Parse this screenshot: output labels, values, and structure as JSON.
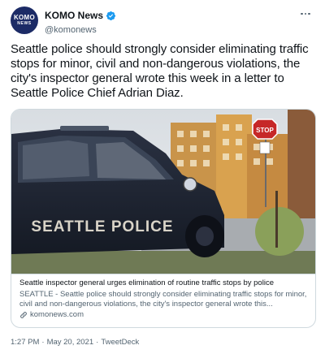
{
  "account": {
    "display_name": "KOMO News",
    "handle": "@komonews",
    "avatar_text_top": "KOMO",
    "avatar_text_bottom": "NEWS",
    "avatar_color": "#1c2b66",
    "verified_color": "#1d9bf0",
    "verified_icon": "verified-badge-icon"
  },
  "tweet": {
    "text": "Seattle police should strongly consider eliminating traffic stops for minor, civil and non-dangerous violations, the city's inspector general wrote this week in a letter to Seattle Police Chief Adrian Diaz.",
    "time": "1:27 PM",
    "date": "May 20, 2021",
    "source": "TweetDeck",
    "separator": "·"
  },
  "card": {
    "image_text": "SEATTLE POLICE",
    "stop_sign_text": "STOP",
    "title": "Seattle inspector general urges elimination of routine traffic stops by police",
    "description": "SEATTLE - Seattle police should strongly consider eliminating traffic stops for minor, civil and non-dangerous violations, the city's inspector general wrote this...",
    "domain": "komonews.com"
  },
  "icons": {
    "more": "more-options-icon",
    "link": "link-icon"
  }
}
